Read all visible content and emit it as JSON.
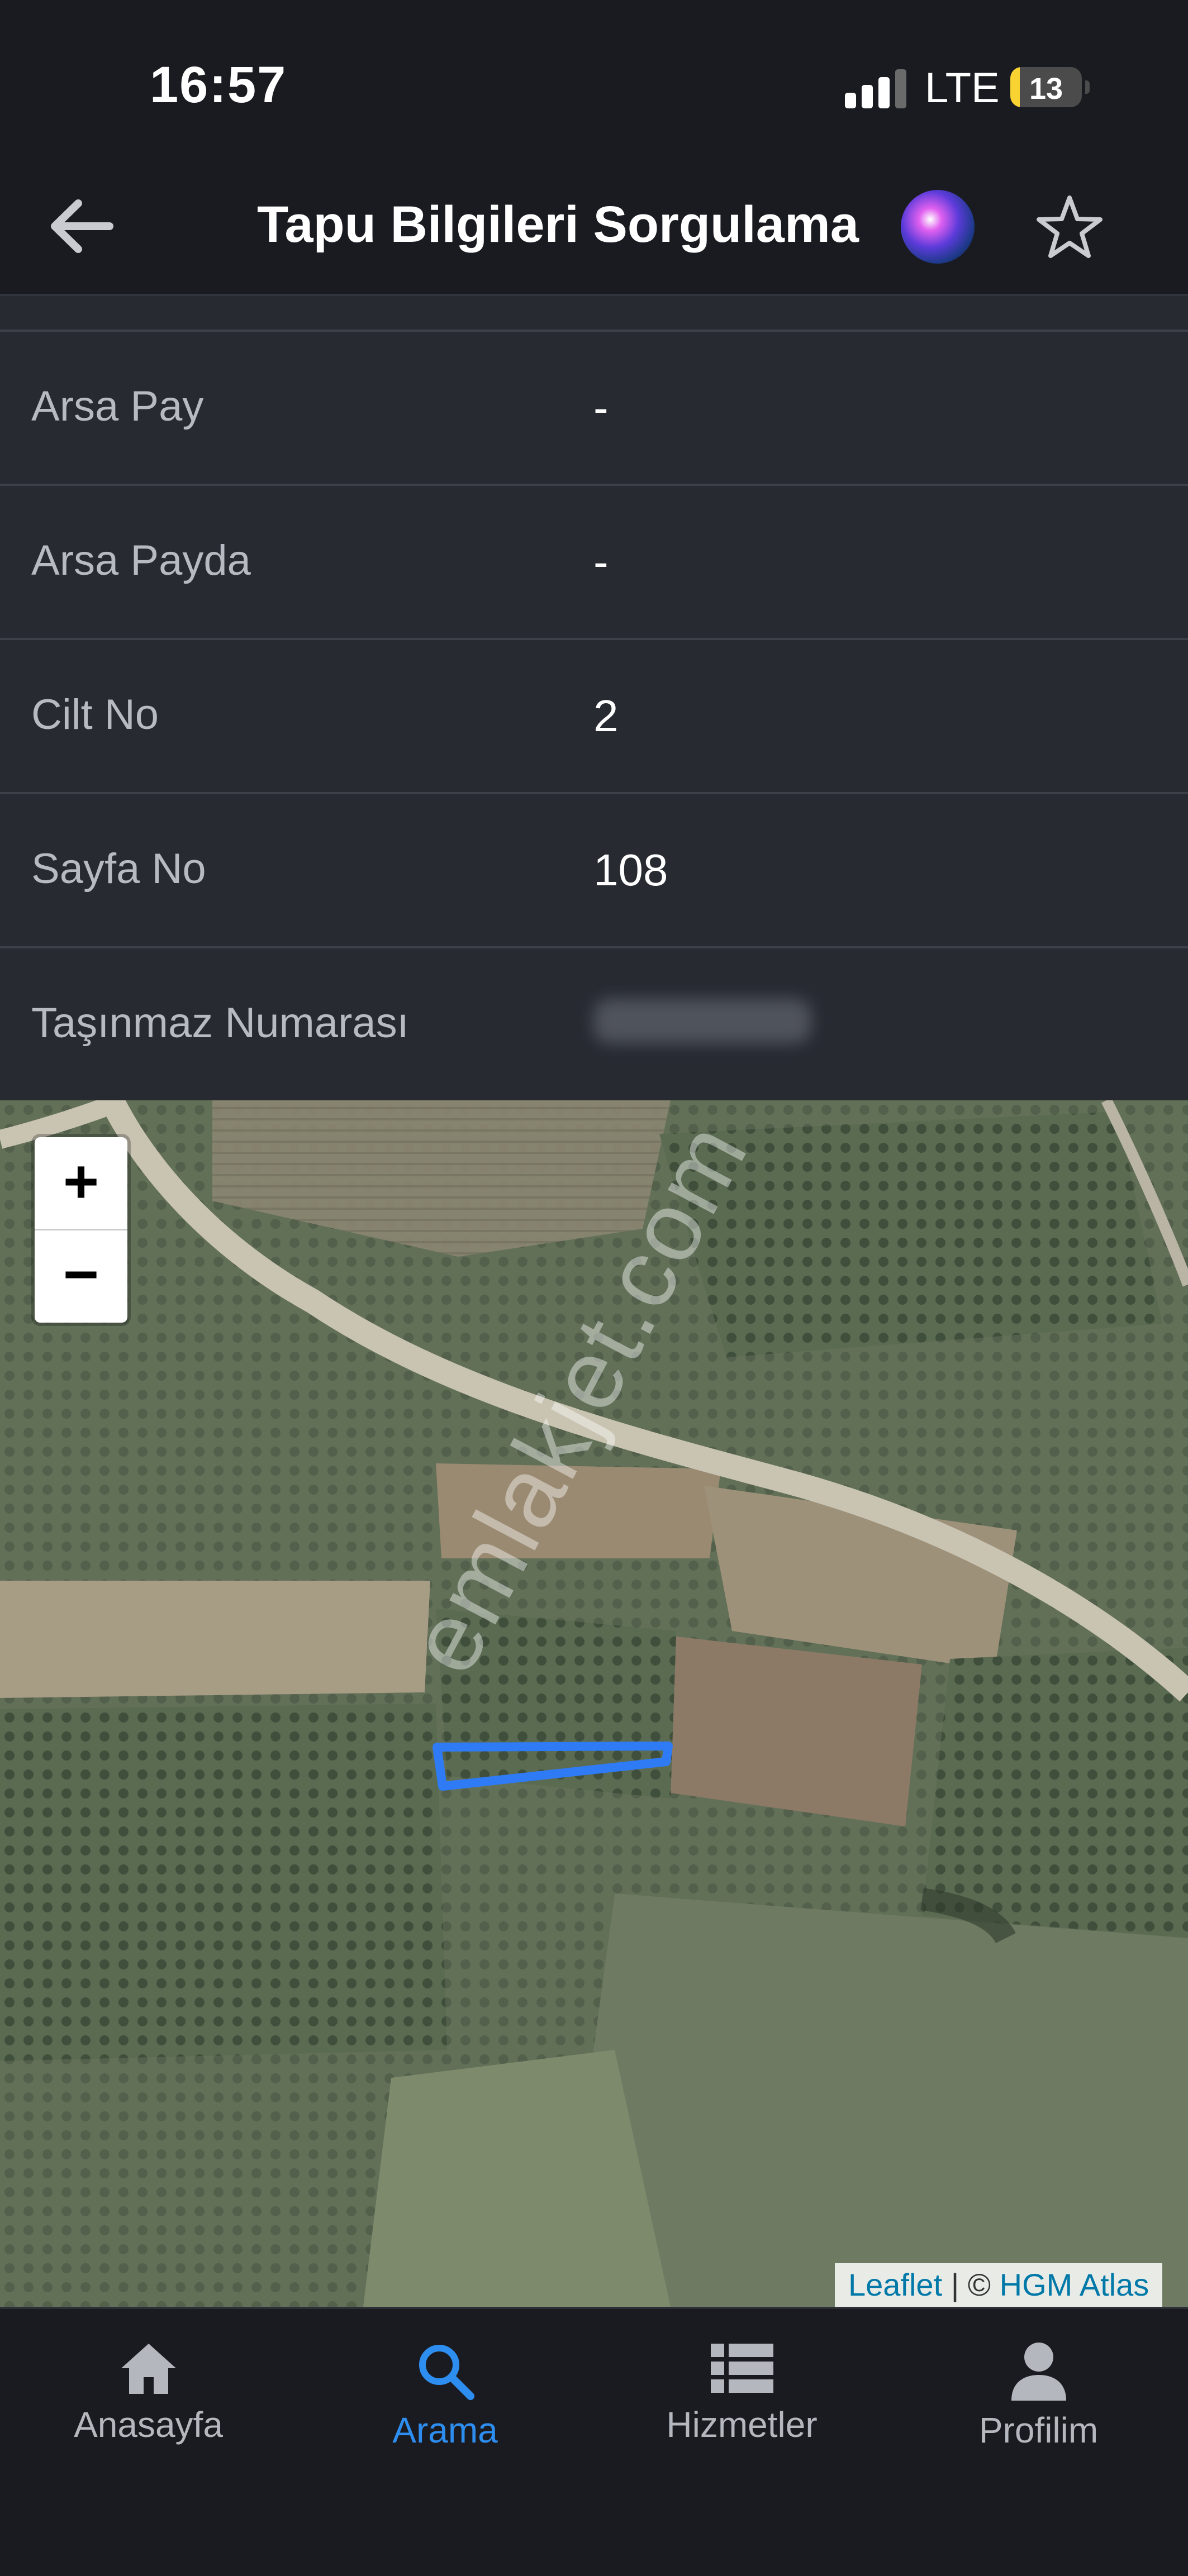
{
  "status_bar": {
    "time": "16:57",
    "network": "LTE",
    "battery_percent": "13",
    "signal_bars_active": 3,
    "battery_color": "#f8d332"
  },
  "nav": {
    "title": "Tapu Bilgileri Sorgulama",
    "back_icon": "arrow-left-icon",
    "assistant_icon": "siri-icon",
    "favorite_icon": "star-outline-icon"
  },
  "info_rows": [
    {
      "label": "Arsa Pay",
      "value": "-"
    },
    {
      "label": "Arsa Payda",
      "value": "-"
    },
    {
      "label": "Cilt No",
      "value": "2"
    },
    {
      "label": "Sayfa No",
      "value": "108"
    },
    {
      "label": "Taşınmaz Numarası",
      "value": ""
    }
  ],
  "map": {
    "zoom_in": "+",
    "zoom_out": "−",
    "attribution": {
      "leaflet": "Leaflet",
      "separator": " | © ",
      "provider": "HGM Atlas"
    },
    "watermark": "emlakjet.com",
    "parcel_color": "#2f7bf5"
  },
  "tabs": [
    {
      "label": "Anasayfa",
      "icon": "home-icon",
      "active": false
    },
    {
      "label": "Arama",
      "icon": "search-icon",
      "active": true
    },
    {
      "label": "Hizmetler",
      "icon": "list-icon",
      "active": false
    },
    {
      "label": "Profilim",
      "icon": "person-icon",
      "active": false
    }
  ],
  "colors": {
    "accent": "#2e8ef0",
    "background": "#272a31",
    "bar": "#1a1b20"
  }
}
